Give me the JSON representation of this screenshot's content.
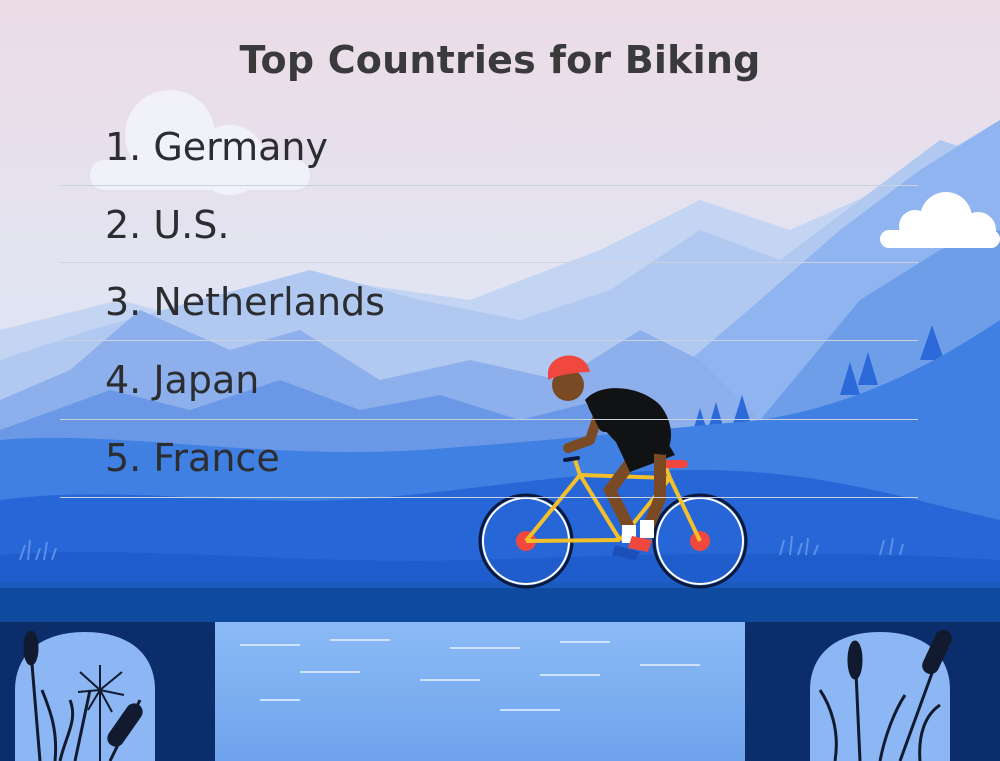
{
  "title": "Top Countries for Biking",
  "countries": [
    {
      "label": "1. Germany"
    },
    {
      "label": "2. U.S."
    },
    {
      "label": "3. Netherlands"
    },
    {
      "label": "4. Japan"
    },
    {
      "label": "5. France"
    }
  ],
  "colors": {
    "sky_top": "#eadbe6",
    "sky_bottom": "#dfe8f6",
    "mountain_far": "#b9cdef",
    "mountain_mid": "#8fb3ee",
    "hill_blue": "#3e7fe0",
    "hill_dark": "#1f5fd0",
    "bridge_deck": "#0e4a9e",
    "bridge_pillar": "#0b2d6a",
    "water": "#7fb0f2",
    "wheel_hub": "#f0483e",
    "bike_frame": "#f3c02b",
    "text": "#2b2d31"
  },
  "icons": [
    "cyclist-illustration",
    "bicycle-icon",
    "cloud-icon",
    "reeds-icon",
    "pine-tree-icon"
  ]
}
